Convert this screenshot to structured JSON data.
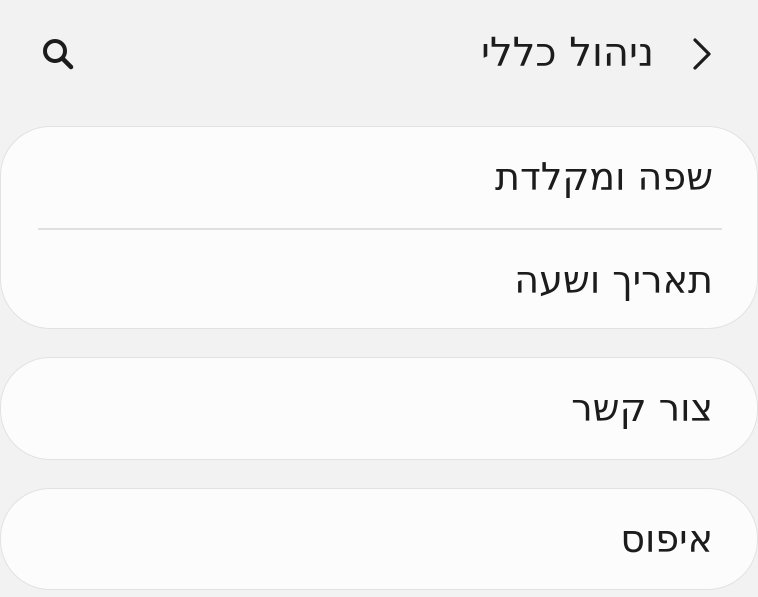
{
  "header": {
    "title": "ניהול כללי",
    "back_icon": "chevron-right-icon",
    "search_icon": "search-icon"
  },
  "groups": [
    {
      "items": [
        {
          "label": "שפה ומקלדת"
        },
        {
          "label": "תאריך ושעה"
        }
      ]
    },
    {
      "items": [
        {
          "label": "צור קשר"
        }
      ]
    },
    {
      "items": [
        {
          "label": "איפוס"
        }
      ]
    }
  ],
  "colors": {
    "background": "#f2f2f2",
    "card": "#fcfcfc",
    "text": "#1c1c1c",
    "divider": "#e0e0e0"
  }
}
